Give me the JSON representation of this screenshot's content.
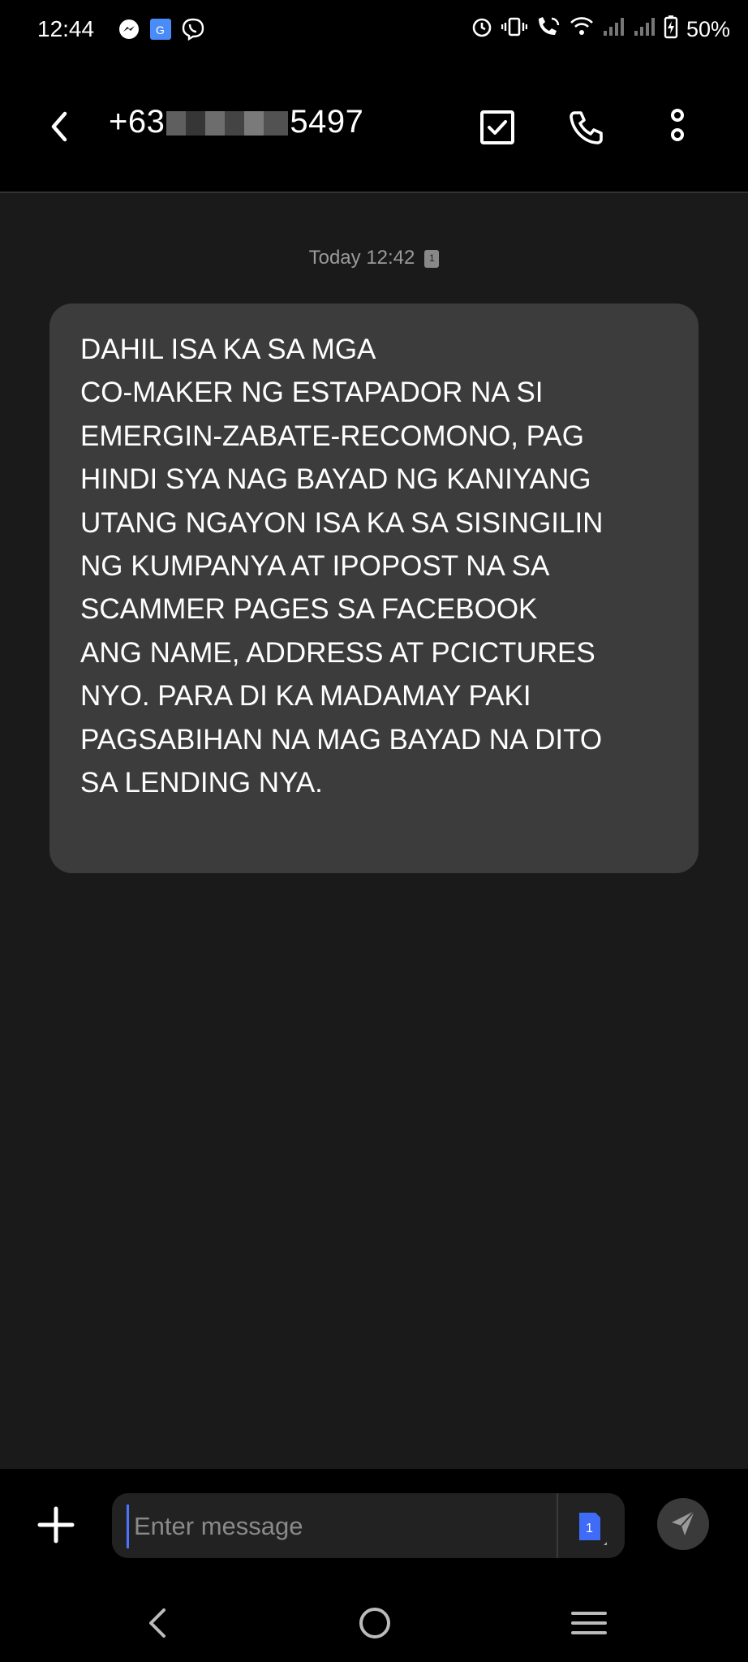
{
  "status_bar": {
    "time": "12:44",
    "battery": "50%",
    "left_icons": [
      "messenger-icon",
      "google-translate-icon",
      "viber-icon"
    ],
    "right_icons": [
      "alarm-icon",
      "vibrate-icon",
      "wifi-call-icon",
      "wifi-icon",
      "signal-icon",
      "signal-icon",
      "battery-charging-icon"
    ]
  },
  "header": {
    "contact_prefix": "+63",
    "contact_suffix": "5497"
  },
  "thread": {
    "timestamp": "Today 12:42",
    "sim_label": "1",
    "message": "DAHIL ISA KA SA MGA\nCO-MAKER NG ESTAPADOR NA SI\nEMERGIN-ZABATE-RECOMONO, PAG\nHINDI SYA NAG BAYAD NG KANIYANG\nUTANG NGAYON ISA KA SA SISINGILIN\nNG KUMPANYA AT IPOPOST NA SA\nSCAMMER PAGES SA FACEBOOK\nANG NAME, ADDRESS AT PCICTURES\nNYO. PARA DI KA MADAMAY PAKI\nPAGSABIHAN NA MAG BAYAD NA DITO\nSA LENDING NYA."
  },
  "composer": {
    "placeholder": "Enter message",
    "sim_label": "1"
  },
  "colors": {
    "background": "#1a1a1a",
    "bubble": "#3c3c3c",
    "accent": "#4d74ff"
  }
}
